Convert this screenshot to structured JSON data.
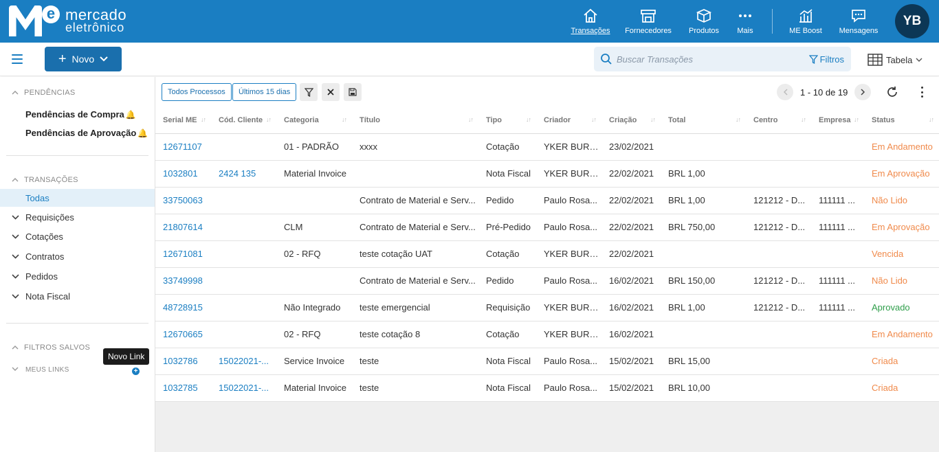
{
  "header": {
    "logo_line1": "mercado",
    "logo_line2": "eletrônico",
    "logo_e": "e",
    "nav": [
      {
        "label": "Transações",
        "icon": "home-icon",
        "active": true
      },
      {
        "label": "Fornecedores",
        "icon": "store-icon"
      },
      {
        "label": "Produtos",
        "icon": "box-icon"
      },
      {
        "label": "Mais",
        "icon": "more-dots-icon"
      },
      {
        "label": "ME Boost",
        "icon": "chart-bars-icon"
      },
      {
        "label": "Mensagens",
        "icon": "message-icon"
      }
    ],
    "avatar_initials": "YB",
    "brand_color": "#1a7ec2"
  },
  "toolbar": {
    "novo_label": "Novo",
    "search_placeholder": "Buscar Transações",
    "filtros_label": "Filtros",
    "view_label": "Tabela"
  },
  "sidebar": {
    "pendencias_title": "PENDÊNCIAS",
    "pendencias": [
      "Pendências de Compra",
      "Pendências de Aprovação"
    ],
    "transacoes_title": "TRANSAÇÕES",
    "todas_label": "Todas",
    "transacoes": [
      "Requisições",
      "Cotações",
      "Contratos",
      "Pedidos",
      "Nota Fiscal"
    ],
    "filtros_salvos_title": "FILTROS SALVOS",
    "meus_links_title": "MEUS LINKS",
    "tooltip": "Novo Link"
  },
  "filters": {
    "chip1": "Todos Processos",
    "chip2": "Últimos 15 dias",
    "pager": "1 - 10 de 19"
  },
  "table": {
    "columns": [
      "Serial ME",
      "Cód. Cliente",
      "Categoria",
      "Título",
      "Tipo",
      "Criador",
      "Criação",
      "Total",
      "Centro",
      "Empresa",
      "Status"
    ],
    "rows": [
      {
        "serial": "12671107",
        "cod": "",
        "categoria": "01 - PADRÃO",
        "titulo": "xxxx",
        "tipo": "Cotação",
        "criador": "YKER BURU...",
        "criacao": "23/02/2021",
        "total": "",
        "centro": "",
        "empresa": "",
        "status": "Em Andamento",
        "status_class": "st-andamento"
      },
      {
        "serial": "1032801",
        "cod": "2424 135",
        "categoria": "Material Invoice",
        "titulo": "",
        "tipo": "Nota Fiscal",
        "criador": "YKER BURU...",
        "criacao": "22/02/2021",
        "total": "BRL 1,00",
        "centro": "",
        "empresa": "",
        "status": "Em Aprovação",
        "status_class": "st-aprovacao"
      },
      {
        "serial": "33750063",
        "cod": "",
        "categoria": "",
        "titulo": "Contrato de Material e Serv...",
        "tipo": "Pedido",
        "criador": "Paulo Rosa...",
        "criacao": "22/02/2021",
        "total": "BRL 1,00",
        "centro": "121212 - D...",
        "empresa": "111111 ...",
        "status": "Não Lido",
        "status_class": "st-naolido"
      },
      {
        "serial": "21807614",
        "cod": "",
        "categoria": "CLM",
        "titulo": "Contrato de Material e Serv...",
        "tipo": "Pré-Pedido",
        "criador": "Paulo Rosa...",
        "criacao": "22/02/2021",
        "total": "BRL 750,00",
        "centro": "121212 - D...",
        "empresa": "111111 ...",
        "status": "Em Aprovação",
        "status_class": "st-aprovacao"
      },
      {
        "serial": "12671081",
        "cod": "",
        "categoria": "02 - RFQ",
        "titulo": "teste cotação UAT",
        "tipo": "Cotação",
        "criador": "YKER BURU...",
        "criacao": "22/02/2021",
        "total": "",
        "centro": "",
        "empresa": "",
        "status": "Vencida",
        "status_class": "st-vencida"
      },
      {
        "serial": "33749998",
        "cod": "",
        "categoria": "",
        "titulo": "Contrato de Material e Serv...",
        "tipo": "Pedido",
        "criador": "Paulo Rosa...",
        "criacao": "16/02/2021",
        "total": "BRL 150,00",
        "centro": "121212 - D...",
        "empresa": "111111 ...",
        "status": "Não Lido",
        "status_class": "st-naolido"
      },
      {
        "serial": "48728915",
        "cod": "",
        "categoria": "Não Integrado",
        "titulo": "teste emergencial",
        "tipo": "Requisição",
        "criador": "YKER BURU...",
        "criacao": "16/02/2021",
        "total": "BRL 1,00",
        "centro": "121212 - D...",
        "empresa": "111111 ...",
        "status": "Aprovado",
        "status_class": "st-aprovado"
      },
      {
        "serial": "12670665",
        "cod": "",
        "categoria": "02 - RFQ",
        "titulo": "teste cotação 8",
        "tipo": "Cotação",
        "criador": "YKER BURU...",
        "criacao": "16/02/2021",
        "total": "",
        "centro": "",
        "empresa": "",
        "status": "Em Andamento",
        "status_class": "st-andamento"
      },
      {
        "serial": "1032786",
        "cod": "15022021-...",
        "categoria": "Service Invoice",
        "titulo": "teste",
        "tipo": "Nota Fiscal",
        "criador": "Paulo Rosa...",
        "criacao": "15/02/2021",
        "total": "BRL 15,00",
        "centro": "",
        "empresa": "",
        "status": "Criada",
        "status_class": "st-criada"
      },
      {
        "serial": "1032785",
        "cod": "15022021-...",
        "categoria": "Material Invoice",
        "titulo": "teste",
        "tipo": "Nota Fiscal",
        "criador": "Paulo Rosa...",
        "criacao": "15/02/2021",
        "total": "BRL 10,00",
        "centro": "",
        "empresa": "",
        "status": "Criada",
        "status_class": "st-criada"
      }
    ]
  }
}
